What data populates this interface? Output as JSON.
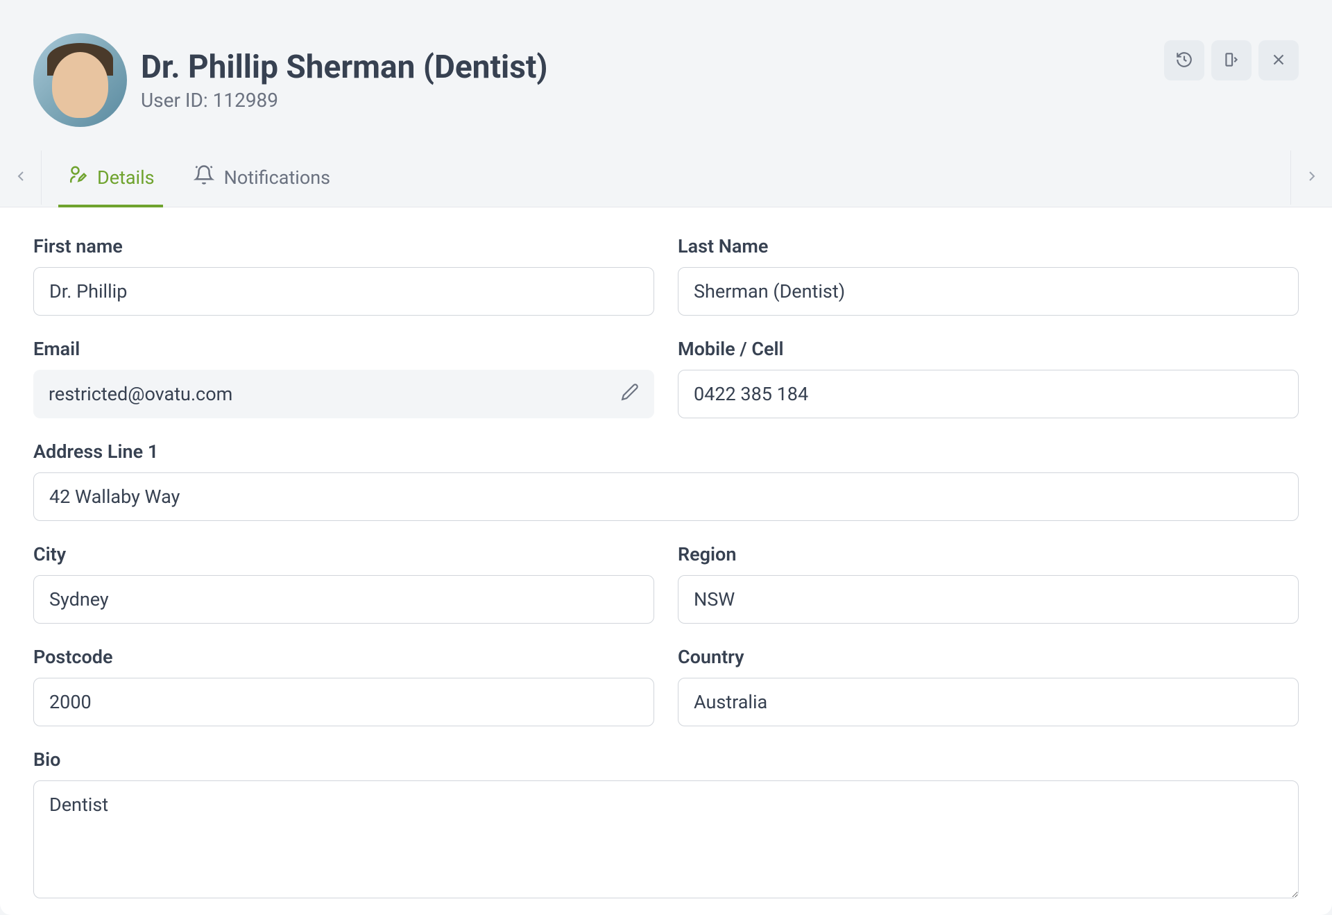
{
  "header": {
    "title": "Dr. Phillip Sherman (Dentist)",
    "subtitle": "User ID: 112989"
  },
  "tabs": {
    "details": "Details",
    "notifications": "Notifications"
  },
  "form": {
    "labels": {
      "first_name": "First name",
      "last_name": "Last Name",
      "email": "Email",
      "mobile": "Mobile / Cell",
      "address1": "Address Line 1",
      "city": "City",
      "region": "Region",
      "postcode": "Postcode",
      "country": "Country",
      "bio": "Bio"
    },
    "values": {
      "first_name": "Dr. Phillip",
      "last_name": "Sherman (Dentist)",
      "email": "restricted@ovatu.com",
      "mobile": "0422 385 184",
      "address1": "42 Wallaby Way",
      "city": "Sydney",
      "region": "NSW",
      "postcode": "2000",
      "country": "Australia",
      "bio": "Dentist"
    }
  }
}
